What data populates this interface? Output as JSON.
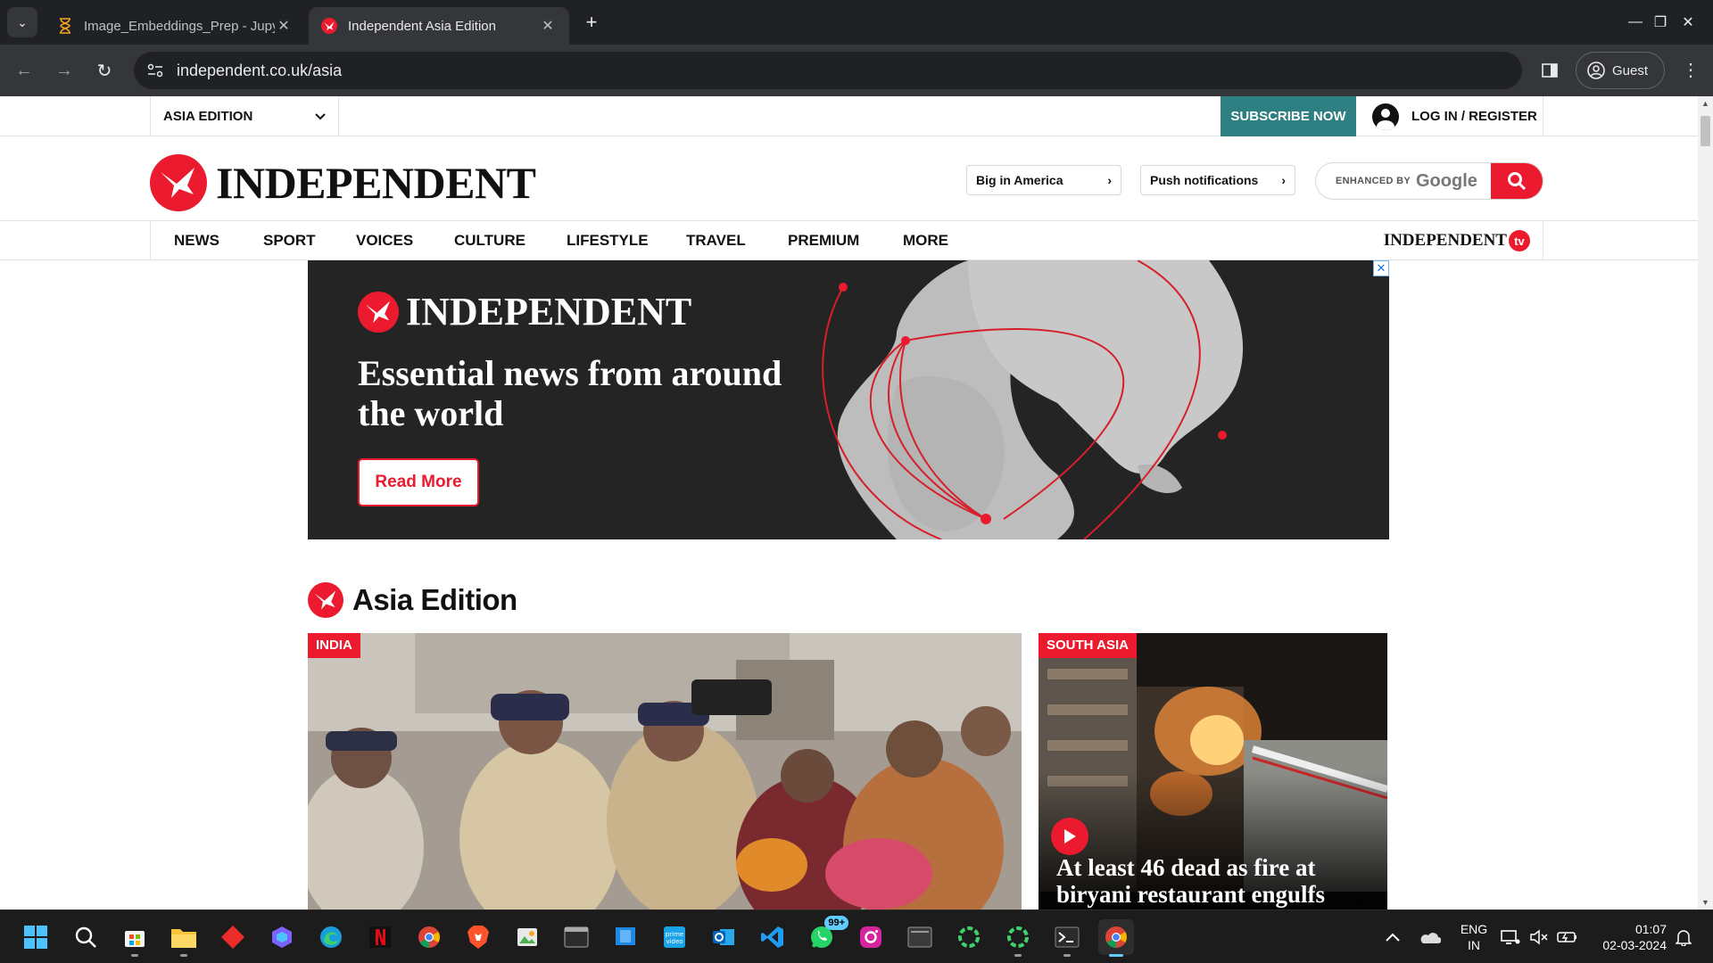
{
  "browser": {
    "tabs": [
      {
        "title": "Image_Embeddings_Prep - Jupyt",
        "active": false
      },
      {
        "title": "Independent Asia Edition",
        "active": true
      }
    ],
    "url": "independent.co.uk/asia",
    "profile_label": "Guest"
  },
  "site": {
    "edition_label": "ASIA EDITION",
    "subscribe_label": "SUBSCRIBE NOW",
    "login_label": "LOG IN / REGISTER",
    "logo_text": "INDEPENDENT",
    "big_in_america": "Big in America",
    "push_notifications": "Push notifications",
    "search_enhanced_label": "ENHANCED BY",
    "search_google_label": "Google",
    "nav": [
      "NEWS",
      "SPORT",
      "VOICES",
      "CULTURE",
      "LIFESTYLE",
      "TRAVEL",
      "PREMIUM",
      "MORE"
    ],
    "tv_logo_text": "INDEPENDENT",
    "tv_badge": "tv"
  },
  "ad": {
    "logo_text": "INDEPENDENT",
    "headline": "Essential news from around the world",
    "cta": "Read More",
    "close": "✕"
  },
  "section": {
    "title": "Asia Edition",
    "cards": [
      {
        "tag": "INDIA",
        "headline": ""
      },
      {
        "tag": "SOUTH ASIA",
        "headline": "At least 46 dead as fire at biryani restaurant engulfs"
      }
    ]
  },
  "taskbar": {
    "whatsapp_badge": "99+",
    "language": [
      "ENG",
      "IN"
    ],
    "time": "01:07",
    "date": "02-03-2024"
  },
  "colors": {
    "brand_red": "#ec1a2e",
    "subscribe_teal": "#2e7f82",
    "banner_bg": "#242424"
  }
}
